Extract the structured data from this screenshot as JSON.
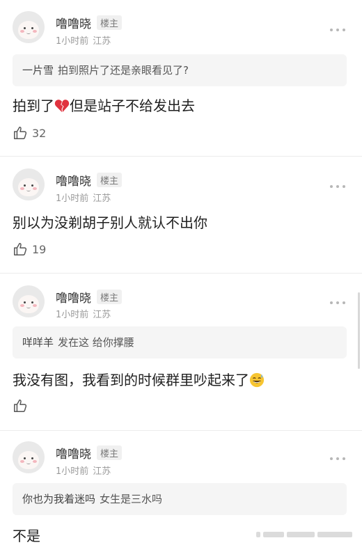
{
  "comments": [
    {
      "name": "噜噜晓",
      "badge": "楼主",
      "time": "1小时前",
      "location": "江苏",
      "quote": {
        "author": "一片雪",
        "text": "拍到照片了还是亲眼看见了?"
      },
      "text_before": "拍到了",
      "emoji": "broken-heart",
      "text_after": "但是站子不给发出去",
      "likes": "32"
    },
    {
      "name": "噜噜晓",
      "badge": "楼主",
      "time": "1小时前",
      "location": "江苏",
      "text": "别以为没剃胡子别人就认不出你",
      "likes": "19"
    },
    {
      "name": "噜噜晓",
      "badge": "楼主",
      "time": "1小时前",
      "location": "江苏",
      "quote": {
        "author": "咩咩羊",
        "text": "发在这 给你撑腰"
      },
      "text_before": "我没有图，我看到的时候群里吵起来了",
      "emoji": "sweat-smile",
      "likes": ""
    },
    {
      "name": "噜噜晓",
      "badge": "楼主",
      "time": "1小时前",
      "location": "江苏",
      "quote": {
        "author": "你也为我着迷吗",
        "text": "女生是三水吗"
      },
      "text": "不是"
    }
  ]
}
